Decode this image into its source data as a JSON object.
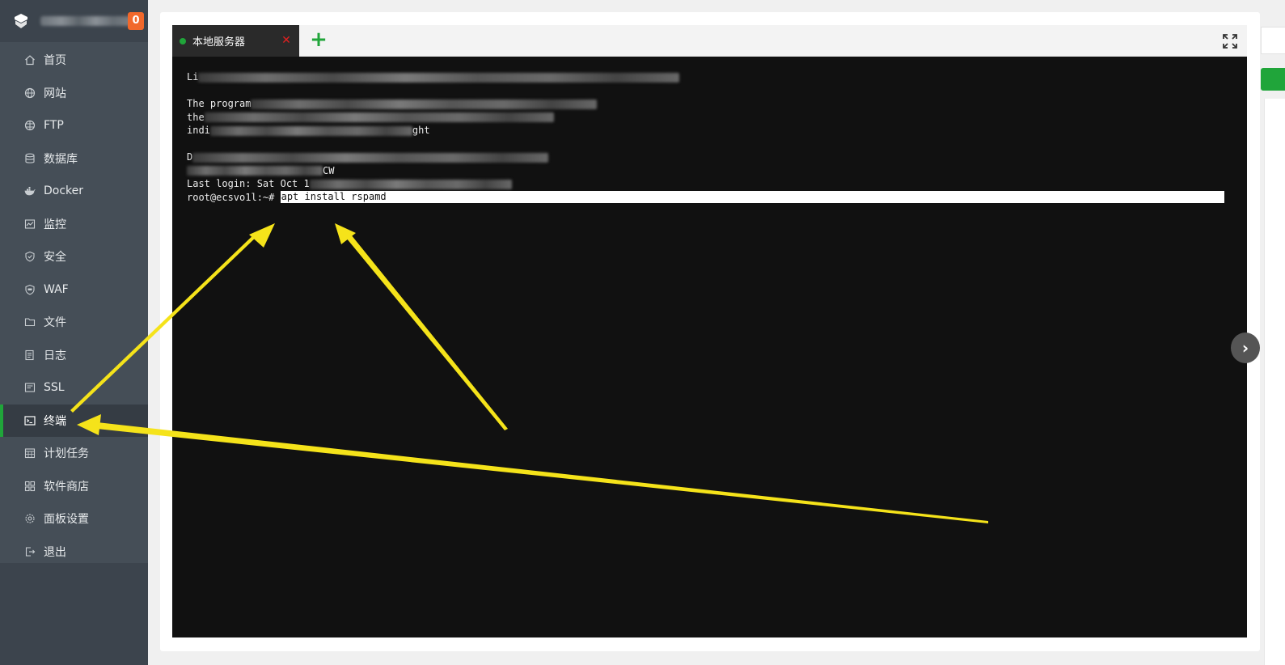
{
  "sidebar": {
    "badge": "0",
    "items": [
      {
        "label": "首页",
        "icon": "home-icon"
      },
      {
        "label": "网站",
        "icon": "globe-icon"
      },
      {
        "label": "FTP",
        "icon": "ftp-globe-icon"
      },
      {
        "label": "数据库",
        "icon": "database-icon"
      },
      {
        "label": "Docker",
        "icon": "docker-icon"
      },
      {
        "label": "监控",
        "icon": "monitor-icon"
      },
      {
        "label": "安全",
        "icon": "shield-icon"
      },
      {
        "label": "WAF",
        "icon": "waf-icon"
      },
      {
        "label": "文件",
        "icon": "folder-icon"
      },
      {
        "label": "日志",
        "icon": "log-icon"
      },
      {
        "label": "SSL",
        "icon": "ssl-icon"
      },
      {
        "label": "终端",
        "icon": "terminal-icon",
        "active": true
      },
      {
        "label": "计划任务",
        "icon": "calendar-icon"
      },
      {
        "label": "软件商店",
        "icon": "grid-icon"
      },
      {
        "label": "面板设置",
        "icon": "gear-icon"
      },
      {
        "label": "退出",
        "icon": "logout-icon"
      }
    ]
  },
  "terminal": {
    "tab_label": "本地服务器",
    "tab_close": "✕",
    "add_tab": "+",
    "lines": {
      "l1_prefix": "Li",
      "l1_tail": "         1.1.0.18  amd64 #1 SMP D",
      "l3_prefix": "The program",
      "l4_prefix": "the",
      "l5_prefix": "indi",
      "l5_tail": "ght",
      "l7_prefix": "D",
      "l8_tail": "CW",
      "last_login": "Last login: Sat Oct 1",
      "prompt": "root@ecsvo1l:~# ",
      "command": "apt install rspamd"
    }
  },
  "colors": {
    "accent": "#20a53a",
    "sidebar_bg": "#454e57",
    "terminal_bg": "#111111",
    "arrow": "#f5e31a",
    "badge": "#f1682b"
  }
}
